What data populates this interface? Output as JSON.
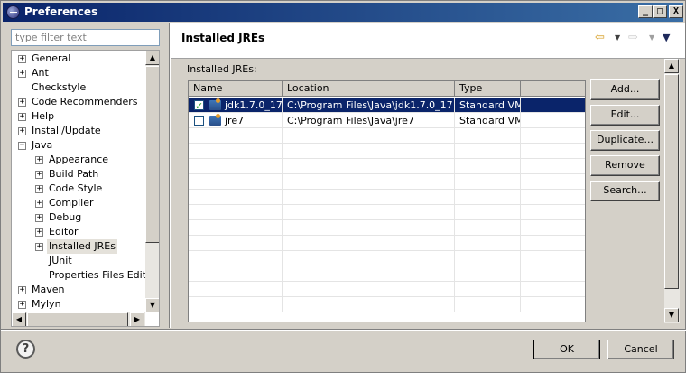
{
  "window": {
    "title": "Preferences"
  },
  "titlebar": {
    "minimize": "_",
    "maximize": "□",
    "close": "X"
  },
  "filter": {
    "placeholder": "type filter text"
  },
  "tree": {
    "items": [
      {
        "label": "General",
        "expander": "+",
        "level": 0
      },
      {
        "label": "Ant",
        "expander": "+",
        "level": 0
      },
      {
        "label": "Checkstyle",
        "expander": "",
        "level": 0
      },
      {
        "label": "Code Recommenders",
        "expander": "+",
        "level": 0
      },
      {
        "label": "Help",
        "expander": "+",
        "level": 0
      },
      {
        "label": "Install/Update",
        "expander": "+",
        "level": 0
      },
      {
        "label": "Java",
        "expander": "−",
        "level": 0
      },
      {
        "label": "Appearance",
        "expander": "+",
        "level": 1
      },
      {
        "label": "Build Path",
        "expander": "+",
        "level": 1
      },
      {
        "label": "Code Style",
        "expander": "+",
        "level": 1
      },
      {
        "label": "Compiler",
        "expander": "+",
        "level": 1
      },
      {
        "label": "Debug",
        "expander": "+",
        "level": 1
      },
      {
        "label": "Editor",
        "expander": "+",
        "level": 1
      },
      {
        "label": "Installed JREs",
        "expander": "+",
        "level": 1,
        "selected": true
      },
      {
        "label": "JUnit",
        "expander": "",
        "level": 1
      },
      {
        "label": "Properties Files Editor",
        "expander": "",
        "level": 1
      },
      {
        "label": "Maven",
        "expander": "+",
        "level": 0
      },
      {
        "label": "Mylyn",
        "expander": "+",
        "level": 0
      }
    ]
  },
  "header": {
    "title": "Installed JREs",
    "back_icon": "⇦",
    "forward_icon": "⇨",
    "dropdown": "▼"
  },
  "section": {
    "label": "Installed JREs:"
  },
  "table": {
    "columns": [
      "Name",
      "Location",
      "Type"
    ],
    "rows": [
      {
        "name": "jdk1.7.0_17",
        "location": "C:\\Program Files\\Java\\jdk1.7.0_17",
        "type": "Standard VM",
        "checked": true,
        "selected": true
      },
      {
        "name": "jre7",
        "location": "C:\\Program Files\\Java\\jre7",
        "type": "Standard VM",
        "checked": false,
        "selected": false
      }
    ]
  },
  "buttons": {
    "add": "Add...",
    "edit": "Edit...",
    "duplicate": "Duplicate...",
    "remove": "Remove",
    "search": "Search...",
    "ok": "OK",
    "cancel": "Cancel"
  },
  "help": {
    "glyph": "?"
  },
  "scroll": {
    "up": "▲",
    "down": "▼",
    "left": "◀",
    "right": "▶"
  },
  "colors": {
    "selection": "#0a246a",
    "titlebar": "#0a246a"
  }
}
